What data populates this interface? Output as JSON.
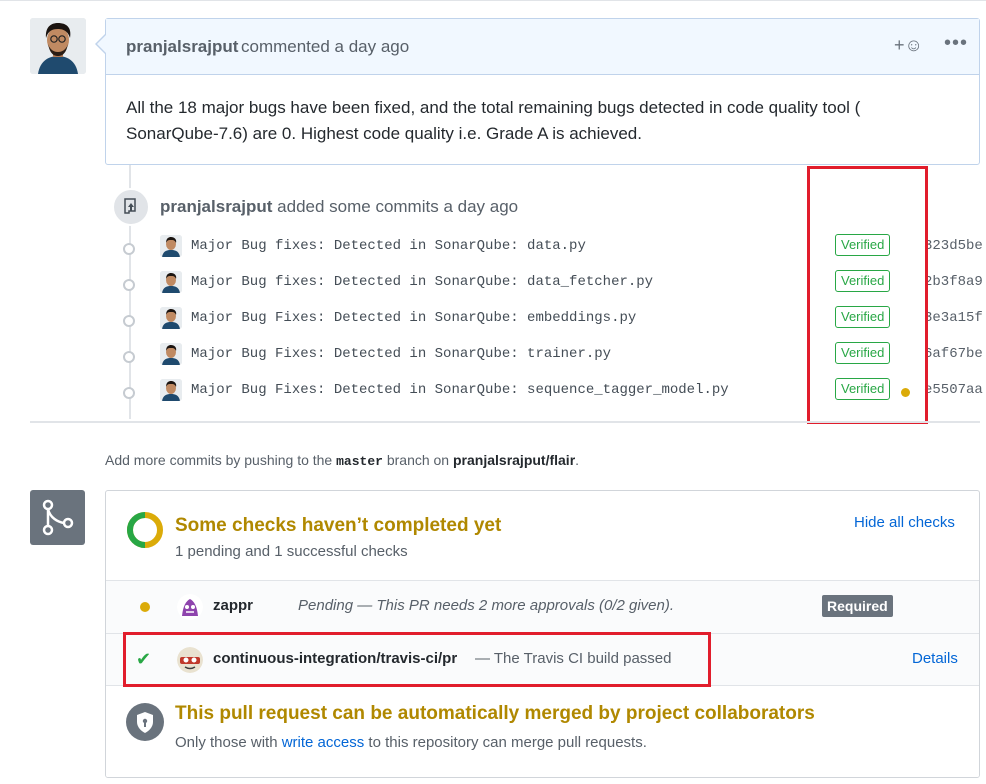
{
  "comment": {
    "author": "pranjalsrajput",
    "action": "commented a day ago",
    "body": "All the 18 major bugs have been fixed, and the total remaining bugs detected in code quality tool ( SonarQube-7.6) are 0. Highest code quality i.e. Grade A is achieved.",
    "reaction_label": "+☺",
    "more_label": "•••"
  },
  "commits_event": {
    "author": "pranjalsrajput",
    "action": "added some commits a day ago"
  },
  "commits": [
    {
      "message": "Major Bug fixes: Detected in SonarQube: data.py",
      "badge": "Verified",
      "sha": "323d5be"
    },
    {
      "message": "Major Bug fixes: Detected in SonarQube: data_fetcher.py",
      "badge": "Verified",
      "sha": "2b3f8a9"
    },
    {
      "message": "Major Bug Fixes: Detected in SonarQube: embeddings.py",
      "badge": "Verified",
      "sha": "3e3a15f"
    },
    {
      "message": "Major Bug Fixes: Detected in SonarQube: trainer.py",
      "badge": "Verified",
      "sha": "6af67be"
    },
    {
      "message": "Major Bug Fixes: Detected in SonarQube: sequence_tagger_model.py",
      "badge": "Verified",
      "sha": "e5507aa"
    }
  ],
  "push_hint": {
    "prefix": "Add more commits by pushing to the",
    "branch": "master",
    "middle": "branch on",
    "repo": "pranjalsrajput/flair",
    "suffix": "."
  },
  "checks": {
    "title": "Some checks haven’t completed yet",
    "subtitle": "1 pending and 1 successful checks",
    "hide_label": "Hide all checks",
    "items": [
      {
        "name": "zappr",
        "description": "Pending — This PR needs 2 more approvals (0/2 given).",
        "badge": "Required",
        "state": "pending"
      },
      {
        "name": "continuous-integration/travis-ci/pr",
        "description": "— The Travis CI build passed",
        "link": "Details",
        "state": "success"
      }
    ]
  },
  "merge": {
    "title": "This pull request can be automatically merged by project collaborators",
    "sub_prefix": "Only those with",
    "sub_link": "write access",
    "sub_suffix": "to this repository can merge pull requests."
  },
  "colors": {
    "highlight": "#e11d2c",
    "verified": "#28a745",
    "pending": "#dbab09",
    "link": "#0366d6"
  }
}
